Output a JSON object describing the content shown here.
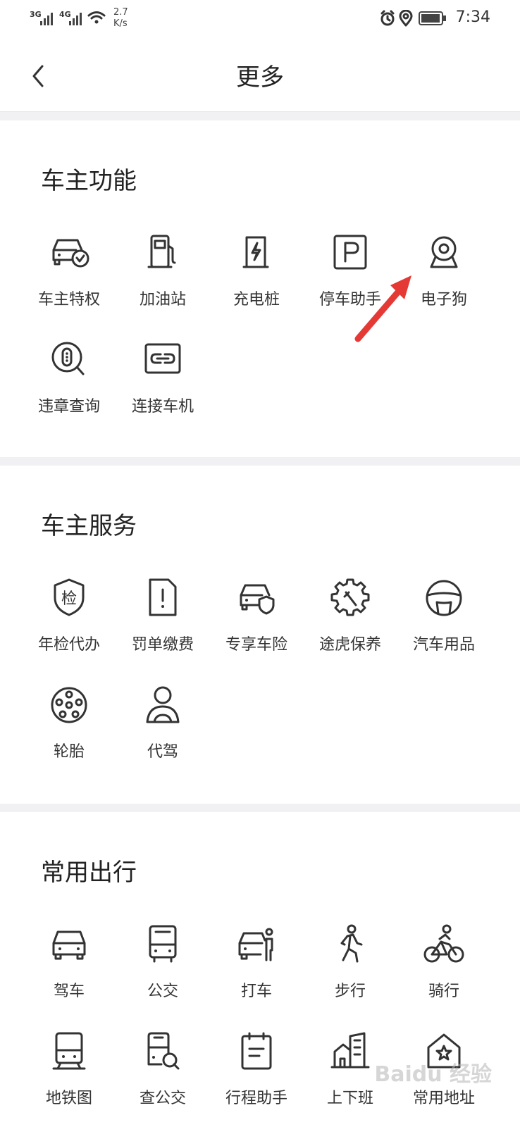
{
  "status_bar": {
    "net1": "3G",
    "net2": "4G",
    "speed_value": "2.7",
    "speed_unit": "K/s",
    "time": "7:34"
  },
  "header": {
    "title": "更多"
  },
  "sections": [
    {
      "title": "车主功能",
      "items": [
        {
          "label": "车主特权",
          "icon": "car-check-icon"
        },
        {
          "label": "加油站",
          "icon": "fuel-pump-icon"
        },
        {
          "label": "充电桩",
          "icon": "charging-pile-icon"
        },
        {
          "label": "停车助手",
          "icon": "parking-icon"
        },
        {
          "label": "电子狗",
          "icon": "camera-icon"
        },
        {
          "label": "违章查询",
          "icon": "violation-search-icon"
        },
        {
          "label": "连接车机",
          "icon": "link-icon"
        }
      ]
    },
    {
      "title": "车主服务",
      "items": [
        {
          "label": "年检代办",
          "icon": "inspection-shield-icon",
          "glyph": "检"
        },
        {
          "label": "罚单缴费",
          "icon": "ticket-doc-icon"
        },
        {
          "label": "专享车险",
          "icon": "car-shield-icon"
        },
        {
          "label": "途虎保养",
          "icon": "gear-wrench-icon"
        },
        {
          "label": "汽车用品",
          "icon": "steering-wheel-icon"
        },
        {
          "label": "轮胎",
          "icon": "tire-icon"
        },
        {
          "label": "代驾",
          "icon": "driver-icon"
        }
      ]
    },
    {
      "title": "常用出行",
      "items": [
        {
          "label": "驾车",
          "icon": "car-icon"
        },
        {
          "label": "公交",
          "icon": "bus-icon"
        },
        {
          "label": "打车",
          "icon": "taxi-icon"
        },
        {
          "label": "步行",
          "icon": "walk-icon"
        },
        {
          "label": "骑行",
          "icon": "bike-icon"
        },
        {
          "label": "地铁图",
          "icon": "subway-icon"
        },
        {
          "label": "查公交",
          "icon": "bus-search-icon"
        },
        {
          "label": "行程助手",
          "icon": "calendar-icon"
        },
        {
          "label": "上下班",
          "icon": "commute-buildings-icon"
        },
        {
          "label": "常用地址",
          "icon": "home-star-icon"
        }
      ]
    }
  ],
  "watermark": "Baidu 经验",
  "colors": {
    "divider": "#f1f1f3",
    "annotation_arrow": "#e53935"
  }
}
